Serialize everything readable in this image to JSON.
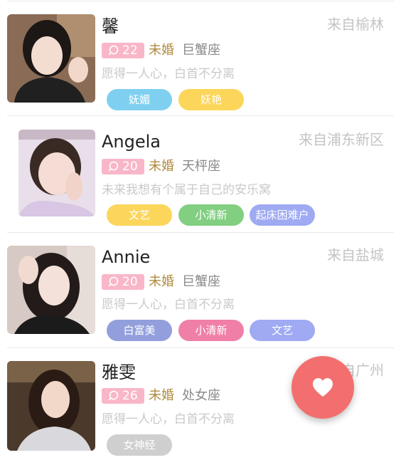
{
  "colors": {
    "age_badge": "#f9b6c8",
    "marital": "#b08a3e",
    "fab": "#f36f6f",
    "tag_blue": "#7fd0f0",
    "tag_yellow": "#fbd65a",
    "tag_green": "#82cf82",
    "tag_purple": "#9faaf3",
    "tag_indigo": "#939fdc",
    "tag_pink": "#f07fa7",
    "tag_gray": "#cfcfcf"
  },
  "users": [
    {
      "name": "馨",
      "location": "来自榆林",
      "age": "22",
      "marital": "未婚",
      "zodiac": "巨蟹座",
      "motto": "愿得一人心，白首不分离",
      "tags": [
        {
          "label": "妩媚",
          "color": "#7fd0f0"
        },
        {
          "label": "妖艳",
          "color": "#fbd65a"
        }
      ]
    },
    {
      "name": "Angela",
      "location": "来自浦东新区",
      "age": "20",
      "marital": "未婚",
      "zodiac": "天枰座",
      "motto": "未来我想有个属于自己的安乐窝",
      "tags": [
        {
          "label": "文艺",
          "color": "#fbd65a"
        },
        {
          "label": "小清新",
          "color": "#82cf82"
        },
        {
          "label": "起床困难户",
          "color": "#9faaf3"
        }
      ]
    },
    {
      "name": "Annie",
      "location": "来自盐城",
      "age": "20",
      "marital": "未婚",
      "zodiac": "巨蟹座",
      "motto": "愿得一人心，白首不分离",
      "tags": [
        {
          "label": "白富美",
          "color": "#939fdc"
        },
        {
          "label": "小清新",
          "color": "#f07fa7"
        },
        {
          "label": "文艺",
          "color": "#9faaf3"
        }
      ]
    },
    {
      "name": "雅雯",
      "location": "来自广州",
      "age": "26",
      "marital": "未婚",
      "zodiac": "处女座",
      "motto": "愿得一人心，白首不分离",
      "tags": [
        {
          "label": "女神经",
          "color": "#cfcfcf"
        }
      ]
    }
  ],
  "fab": {
    "icon": "heart-icon"
  }
}
